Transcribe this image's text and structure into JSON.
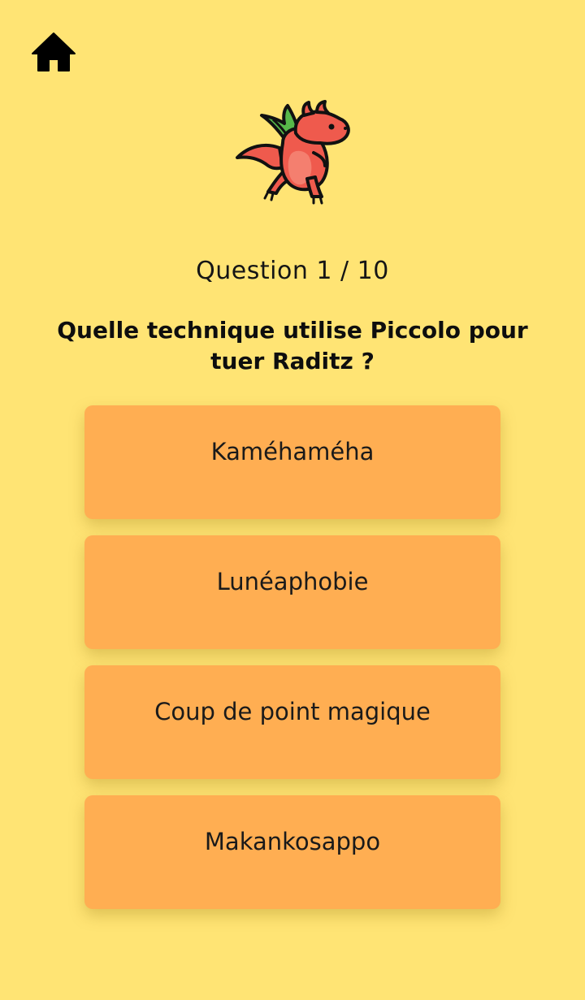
{
  "header": {
    "home_icon": "home-icon"
  },
  "mascot": {
    "icon": "dragon-icon",
    "colors": {
      "body": "#ef5a4d",
      "belly": "#f47f6f",
      "wing": "#58b84a",
      "outline": "#111111"
    }
  },
  "quiz": {
    "counter": "Question 1 / 10",
    "question": "Quelle technique utilise Piccolo pour tuer Raditz ?",
    "answers": [
      {
        "label": "Kaméhaméha"
      },
      {
        "label": "Lunéaphobie"
      },
      {
        "label": "Coup de point magique"
      },
      {
        "label": "Makankosappo"
      }
    ]
  },
  "colors": {
    "background": "#ffe474",
    "answer_button": "#ffae52",
    "text": "#111111"
  }
}
